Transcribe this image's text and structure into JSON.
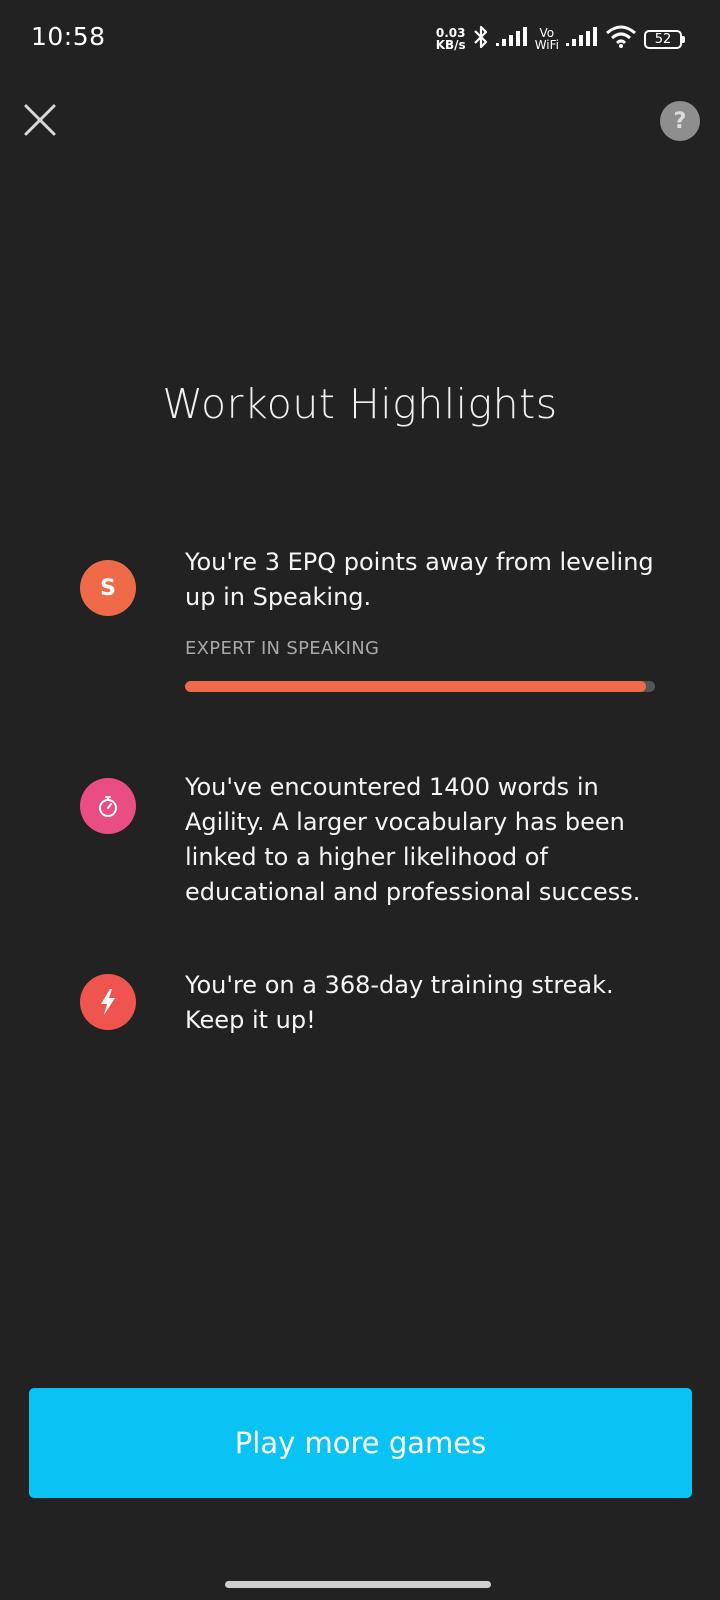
{
  "status_bar": {
    "time": "10:58",
    "net_speed_value": "0.03",
    "net_speed_unit": "KB/s",
    "vowifi_top": "Vo",
    "vowifi_bottom": "WiFi",
    "battery": "52"
  },
  "header": {
    "help_label": "?",
    "title": "Workout Highlights"
  },
  "highlights": [
    {
      "icon": "speaking-s-icon",
      "icon_label": "S",
      "icon_color": "#ee6a48",
      "text": "You're 3 EPQ points away from leveling up in Speaking.",
      "sublabel": "EXPERT IN SPEAKING",
      "progress": 0.98
    },
    {
      "icon": "stopwatch-icon",
      "icon_color": "#ea4d83",
      "text": "You've encountered 1400 words in Agility. A larger vocabulary has been linked to a higher likelihood of educational and professional success."
    },
    {
      "icon": "lightning-bolt-icon",
      "icon_color": "#f0544f",
      "text": "You're on a 368-day training streak. Keep it up!"
    }
  ],
  "cta": {
    "label": "Play more games",
    "color": "#08c3f3"
  }
}
